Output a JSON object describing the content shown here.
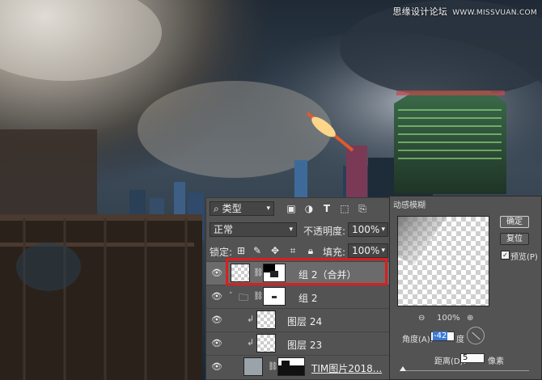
{
  "watermark": {
    "site_name": "思缘设计论坛",
    "site_url": "WWW.MISSVUAN.COM"
  },
  "layers_panel": {
    "filter_kind": "类型",
    "blend_mode": "正常",
    "opacity_label": "不透明度:",
    "opacity_value": "100%",
    "lock_label": "锁定:",
    "fill_label": "填充:",
    "fill_value": "100%",
    "layers": [
      {
        "name": "组 2（合并）",
        "selected": true,
        "has_mask": true
      },
      {
        "name": "组 2",
        "type": "group",
        "has_mask": true
      },
      {
        "name": "图层 24",
        "clipped": true
      },
      {
        "name": "图层 23",
        "clipped": true
      },
      {
        "name": "TIM图片2018...",
        "has_mask": true
      }
    ]
  },
  "motion_blur_dialog": {
    "title": "动感模糊",
    "ok_label": "确定",
    "reset_label": "复位",
    "preview_label": "预览(P)",
    "preview_checked": true,
    "zoom_value": "100%",
    "angle_label": "角度(A):",
    "angle_value": "-42",
    "angle_unit": "度",
    "distance_label": "距离(D):",
    "distance_value": "5",
    "distance_unit": "像素"
  },
  "colors": {
    "panel_bg": "#535353",
    "highlight": "#d8201f",
    "selection_blue": "#3a78d4"
  }
}
